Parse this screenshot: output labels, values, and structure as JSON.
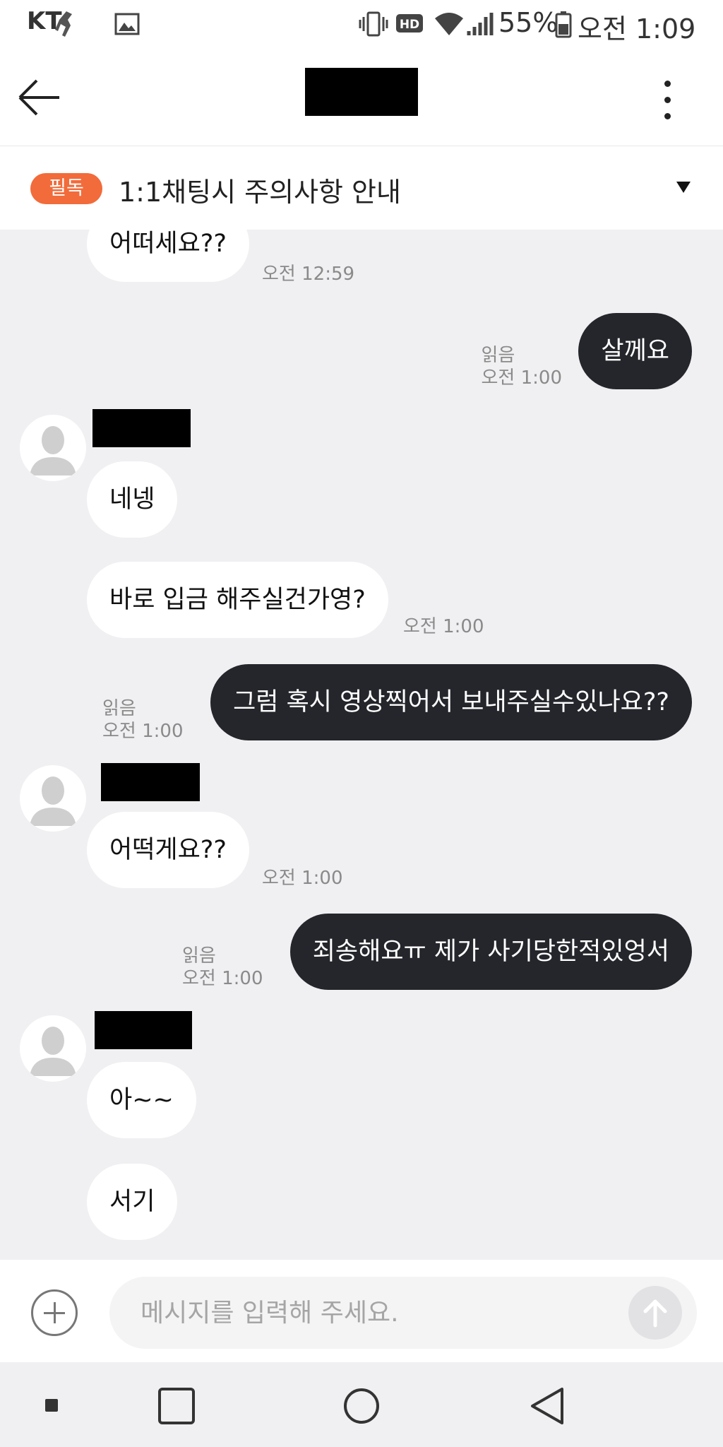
{
  "status_bar": {
    "carrier": "KT",
    "battery": "55%",
    "time": "오전 1:09",
    "icons": [
      "runner-icon",
      "image-icon",
      "vibrate-icon",
      "hd-icon",
      "wifi-icon",
      "signal-icon",
      "battery-icon"
    ]
  },
  "header": {
    "back_icon": "arrow-left-icon",
    "menu_icon": "more-vertical-icon"
  },
  "notice": {
    "badge": "필독",
    "title": "1:1채팅시 주의사항 안내",
    "toggle_icon": "triangle-down-icon"
  },
  "messages": [
    {
      "side": "in",
      "text": "어떠세요??",
      "time": "오전 12:59"
    },
    {
      "side": "out",
      "text": "살께요",
      "read": "읽음",
      "time": "오전 1:00"
    },
    {
      "side": "in",
      "text": "네넹"
    },
    {
      "side": "in",
      "text": "바로 입금 해주실건가영?",
      "time": "오전 1:00"
    },
    {
      "side": "out",
      "text": "그럼 혹시 영상찍어서 보내주실수있나요??",
      "read": "읽음",
      "time": "오전 1:00"
    },
    {
      "side": "in",
      "text": "어떡게요??",
      "time": "오전 1:00"
    },
    {
      "side": "out",
      "text": "죄송해요ㅠ 제가 사기당한적있엉서",
      "read": "읽음",
      "time": "오전 1:00"
    },
    {
      "side": "in",
      "text": "아~~"
    },
    {
      "side": "in",
      "text": "서기"
    }
  ],
  "input": {
    "placeholder": "메시지를 입력해 주세요.",
    "add_icon": "plus-circle-icon",
    "send_icon": "arrow-up-icon"
  },
  "nav_bar": {
    "icons": [
      "small-square-icon",
      "recents-square-icon",
      "home-circle-icon",
      "back-triangle-icon"
    ]
  }
}
